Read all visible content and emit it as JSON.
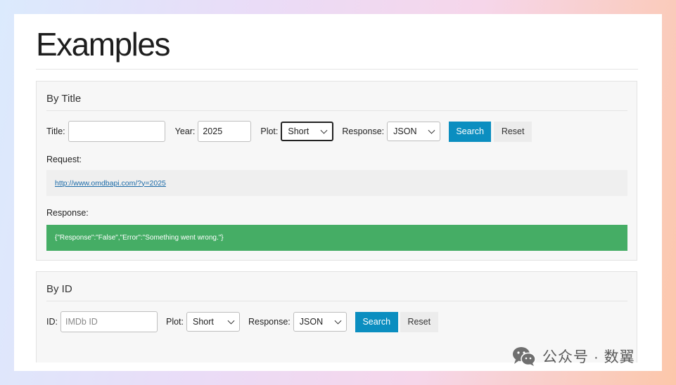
{
  "page": {
    "title": "Examples"
  },
  "by_title": {
    "heading": "By Title",
    "title_label": "Title:",
    "title_value": "",
    "year_label": "Year:",
    "year_value": "2025",
    "plot_label": "Plot:",
    "plot_value": "Short",
    "response_label": "Response:",
    "response_value": "JSON",
    "search_label": "Search",
    "reset_label": "Reset",
    "request_label": "Request:",
    "request_url": "http://www.omdbapi.com/?y=2025",
    "response_section_label": "Response:",
    "response_body": "{\"Response\":\"False\",\"Error\":\"Something went wrong.\"}"
  },
  "by_id": {
    "heading": "By ID",
    "id_label": "ID:",
    "id_placeholder": "IMDb ID",
    "plot_label": "Plot:",
    "plot_value": "Short",
    "response_label": "Response:",
    "response_value": "JSON",
    "search_label": "Search",
    "reset_label": "Reset"
  },
  "watermark": {
    "text": "公众号 · 数翼",
    "icon": "wechat-icon"
  },
  "colors": {
    "primary_button": "#0b8ec0",
    "response_success": "#45ad65",
    "link": "#1a6aa8"
  }
}
